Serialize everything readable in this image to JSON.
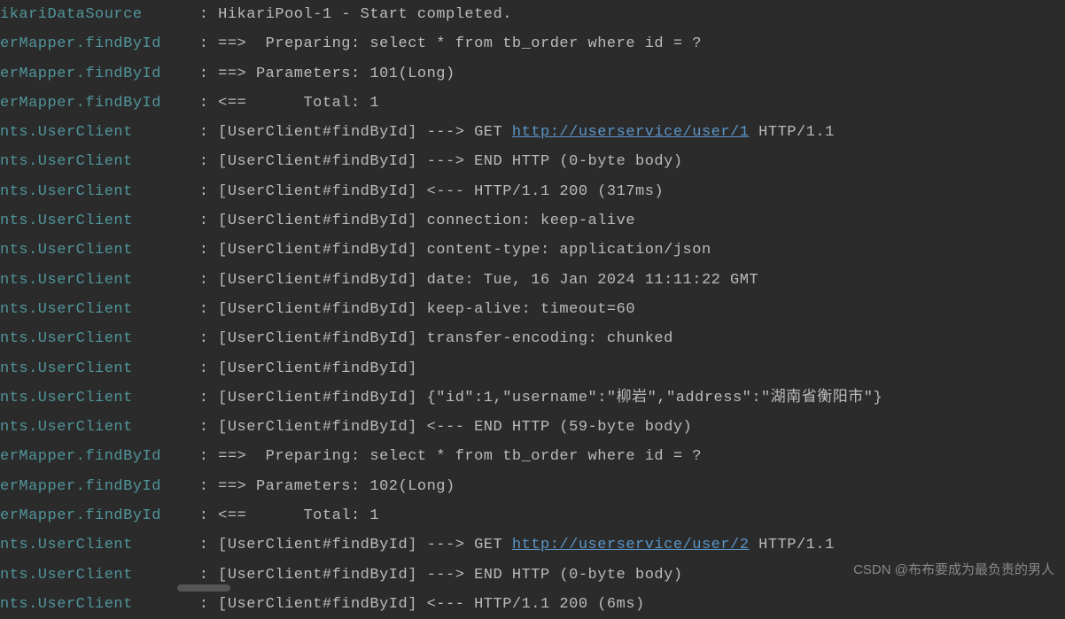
{
  "lines": [
    {
      "logger": "ikariDataSource",
      "msg_pre": "HikariPool-1 - Start completed."
    },
    {
      "logger": "erMapper.findById",
      "msg_pre": "==>  Preparing: select * from tb_order where id = ?"
    },
    {
      "logger": "erMapper.findById",
      "msg_pre": "==> Parameters: 101(Long)"
    },
    {
      "logger": "erMapper.findById",
      "msg_pre": "<==      Total: 1"
    },
    {
      "logger": "nts.UserClient",
      "msg_pre": "[UserClient#findById] ---> GET ",
      "link": "http://userservice/user/1",
      "msg_post": " HTTP/1.1"
    },
    {
      "logger": "nts.UserClient",
      "msg_pre": "[UserClient#findById] ---> END HTTP (0-byte body)"
    },
    {
      "logger": "nts.UserClient",
      "msg_pre": "[UserClient#findById] <--- HTTP/1.1 200 (317ms)"
    },
    {
      "logger": "nts.UserClient",
      "msg_pre": "[UserClient#findById] connection: keep-alive"
    },
    {
      "logger": "nts.UserClient",
      "msg_pre": "[UserClient#findById] content-type: application/json"
    },
    {
      "logger": "nts.UserClient",
      "msg_pre": "[UserClient#findById] date: Tue, 16 Jan 2024 11:11:22 GMT"
    },
    {
      "logger": "nts.UserClient",
      "msg_pre": "[UserClient#findById] keep-alive: timeout=60"
    },
    {
      "logger": "nts.UserClient",
      "msg_pre": "[UserClient#findById] transfer-encoding: chunked"
    },
    {
      "logger": "nts.UserClient",
      "msg_pre": "[UserClient#findById] "
    },
    {
      "logger": "nts.UserClient",
      "msg_pre": "[UserClient#findById] {\"id\":1,\"username\":\"柳岩\",\"address\":\"湖南省衡阳市\"}"
    },
    {
      "logger": "nts.UserClient",
      "msg_pre": "[UserClient#findById] <--- END HTTP (59-byte body)"
    },
    {
      "logger": "erMapper.findById",
      "msg_pre": "==>  Preparing: select * from tb_order where id = ?"
    },
    {
      "logger": "erMapper.findById",
      "msg_pre": "==> Parameters: 102(Long)"
    },
    {
      "logger": "erMapper.findById",
      "msg_pre": "<==      Total: 1"
    },
    {
      "logger": "nts.UserClient",
      "msg_pre": "[UserClient#findById] ---> GET ",
      "link": "http://userservice/user/2",
      "msg_post": " HTTP/1.1"
    },
    {
      "logger": "nts.UserClient",
      "msg_pre": "[UserClient#findById] ---> END HTTP (0-byte body)"
    },
    {
      "logger": "nts.UserClient",
      "msg_pre": "[UserClient#findById] <--- HTTP/1.1 200 (6ms)"
    }
  ],
  "watermark": "CSDN @布布要成为最负责的男人"
}
